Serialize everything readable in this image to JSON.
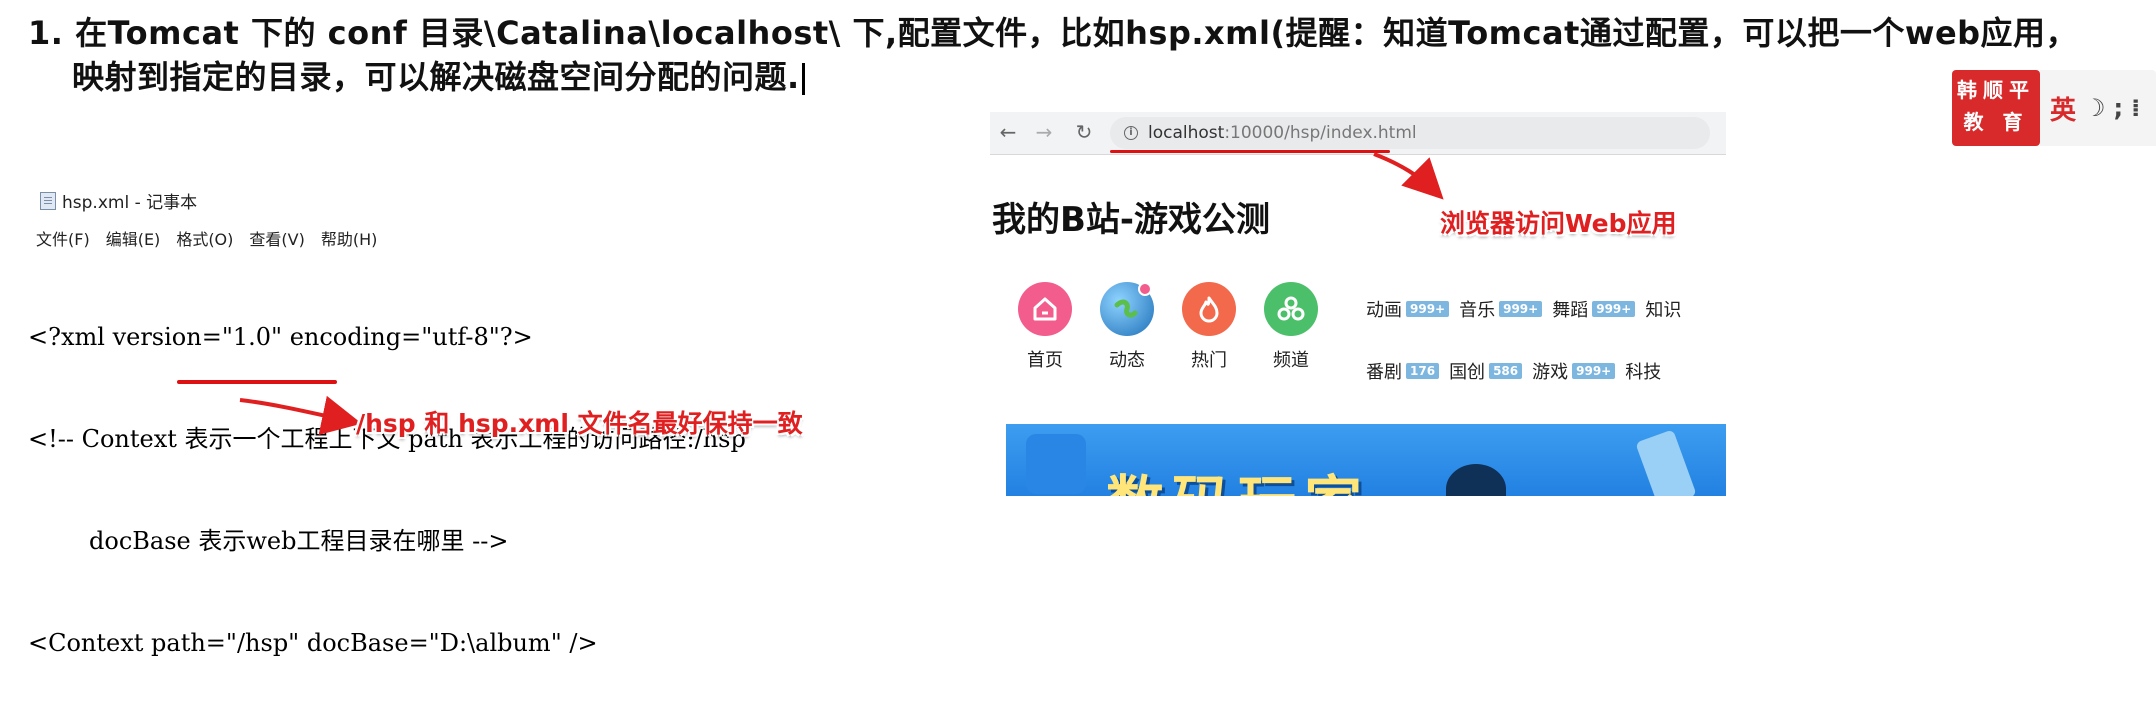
{
  "instruction": {
    "line1": "1. 在Tomcat 下的 conf 目录\\Catalina\\localhost\\ 下,配置文件，比如hsp.xml(提醒：知道Tomcat通过配置，可以把一个web应用，",
    "line2": "映射到指定的目录，可以解决磁盘空间分配的问题."
  },
  "brand": {
    "line1": "韩顺平",
    "line2": "教 育",
    "ime_label": "英"
  },
  "notepad": {
    "title": "hsp.xml - 记事本",
    "menu": [
      "文件(F)",
      "编辑(E)",
      "格式(O)",
      "查看(V)",
      "帮助(H)"
    ],
    "code_lines": [
      "<?xml version=\"1.0\" encoding=\"utf-8\"?>",
      "<!-- Context 表示一个工程上下文 path 表示工程的访问路径:/hsp",
      "        docBase 表示web工程目录在哪里 -->",
      "<Context path=\"/hsp\" docBase=\"D:\\album\" />"
    ]
  },
  "annotations": {
    "path_note": "/hsp 和  hsp.xml 文件名最好保持一致",
    "browser_note": "浏览器访问Web应用"
  },
  "browser": {
    "url_host": "localhost",
    "url_rest": ":10000/hsp/index.html",
    "site_title": "我的B站-游戏公测",
    "nav_icons": [
      {
        "label": "首页",
        "icon": "home-icon",
        "color": "#f25d8e"
      },
      {
        "label": "动态",
        "icon": "globe-icon",
        "color": "#3aa0e0"
      },
      {
        "label": "热门",
        "icon": "fire-icon",
        "color": "#f2694b"
      },
      {
        "label": "频道",
        "icon": "channel-icon",
        "color": "#4cbf6b"
      }
    ],
    "categories_row1": [
      {
        "name": "动画",
        "count": "999+"
      },
      {
        "name": "音乐",
        "count": "999+"
      },
      {
        "name": "舞蹈",
        "count": "999+"
      },
      {
        "name": "知识",
        "count": ""
      }
    ],
    "categories_row2": [
      {
        "name": "番剧",
        "count": "176"
      },
      {
        "name": "国创",
        "count": "586"
      },
      {
        "name": "游戏",
        "count": "999+"
      },
      {
        "name": "科技",
        "count": ""
      }
    ],
    "banner_text": "数码玩家"
  },
  "colors": {
    "annotation_red": "#e02020",
    "brand_red": "#d82a2a"
  }
}
